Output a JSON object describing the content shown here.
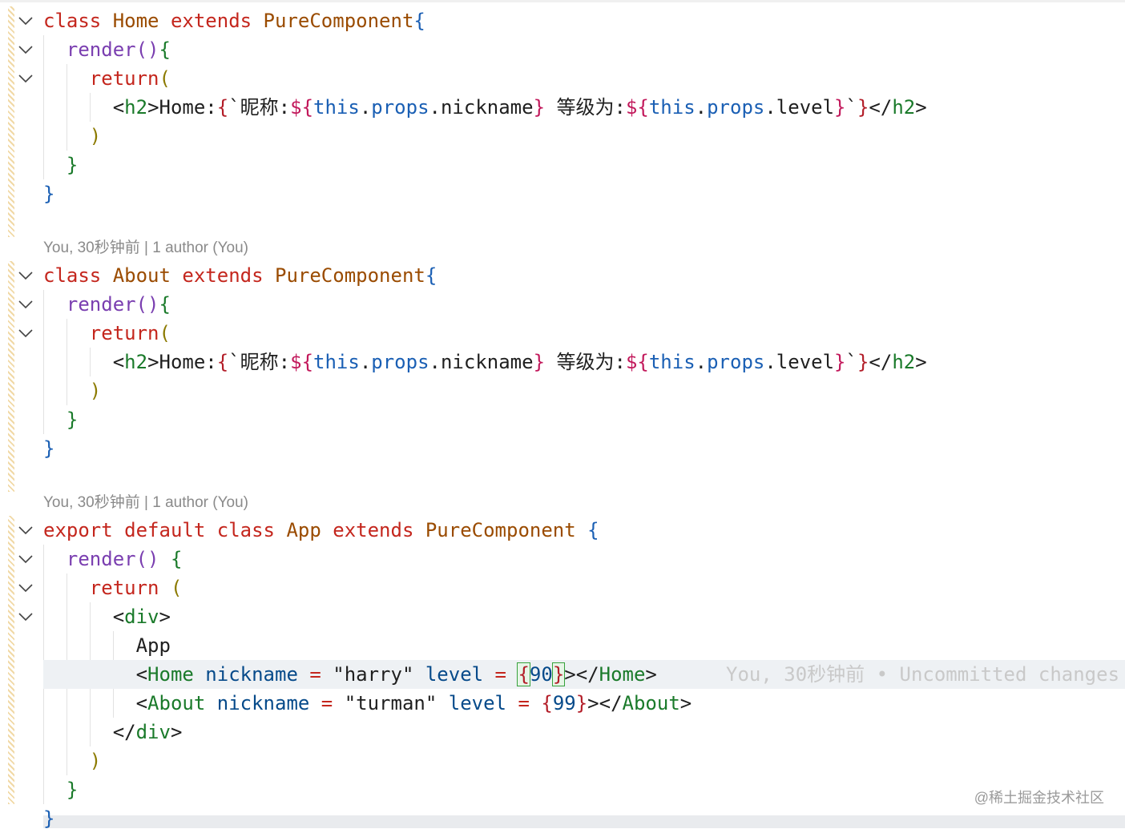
{
  "blocks": [
    {
      "lens": "",
      "lines": [
        [
          [
            "class ",
            "k-red"
          ],
          [
            "Home ",
            "k-cls"
          ],
          [
            "extends ",
            "k-red"
          ],
          [
            "PureComponent",
            "k-cls"
          ],
          [
            "{",
            "k-blue"
          ]
        ],
        [
          [
            "  "
          ],
          [
            "render",
            "k-purple"
          ],
          [
            "()",
            "k-purple"
          ],
          [
            "{",
            "k-green"
          ]
        ],
        [
          [
            "    "
          ],
          [
            "return",
            "k-red"
          ],
          [
            "(",
            "k-olive"
          ]
        ],
        [
          [
            "      "
          ],
          [
            "<",
            "k-dark"
          ],
          [
            "h2",
            "k-green"
          ],
          [
            ">Home:",
            "k-dark"
          ],
          [
            "{",
            "k-red2"
          ],
          [
            "`昵称:",
            "k-dark"
          ],
          [
            "${",
            "k-pink"
          ],
          [
            "this",
            "k-blue"
          ],
          [
            ".",
            "k-dark"
          ],
          [
            "props",
            "k-blue"
          ],
          [
            ".nickname",
            "k-dark"
          ],
          [
            "}",
            "k-pink"
          ],
          [
            " 等级为:",
            "k-dark"
          ],
          [
            "${",
            "k-pink"
          ],
          [
            "this",
            "k-blue"
          ],
          [
            ".",
            "k-dark"
          ],
          [
            "props",
            "k-blue"
          ],
          [
            ".level",
            "k-dark"
          ],
          [
            "}",
            "k-pink"
          ],
          [
            "`",
            "k-dark"
          ],
          [
            "}",
            "k-red2"
          ],
          [
            "</",
            "k-dark"
          ],
          [
            "h2",
            "k-green"
          ],
          [
            ">",
            "k-dark"
          ]
        ],
        [
          [
            "    "
          ],
          [
            ")",
            "k-olive"
          ]
        ],
        [
          [
            "  "
          ],
          [
            "}",
            "k-green"
          ]
        ],
        [
          [
            "}",
            "k-blue"
          ]
        ]
      ]
    },
    {
      "lens": "You, 30秒钟前 | 1 author (You)",
      "lines": [
        [
          [
            "class ",
            "k-red"
          ],
          [
            "About ",
            "k-cls"
          ],
          [
            "extends ",
            "k-red"
          ],
          [
            "PureComponent",
            "k-cls"
          ],
          [
            "{",
            "k-blue"
          ]
        ],
        [
          [
            "  "
          ],
          [
            "render",
            "k-purple"
          ],
          [
            "()",
            "k-purple"
          ],
          [
            "{",
            "k-green"
          ]
        ],
        [
          [
            "    "
          ],
          [
            "return",
            "k-red"
          ],
          [
            "(",
            "k-olive"
          ]
        ],
        [
          [
            "      "
          ],
          [
            "<",
            "k-dark"
          ],
          [
            "h2",
            "k-green"
          ],
          [
            ">Home:",
            "k-dark"
          ],
          [
            "{",
            "k-red2"
          ],
          [
            "`昵称:",
            "k-dark"
          ],
          [
            "${",
            "k-pink"
          ],
          [
            "this",
            "k-blue"
          ],
          [
            ".",
            "k-dark"
          ],
          [
            "props",
            "k-blue"
          ],
          [
            ".nickname",
            "k-dark"
          ],
          [
            "}",
            "k-pink"
          ],
          [
            " 等级为:",
            "k-dark"
          ],
          [
            "${",
            "k-pink"
          ],
          [
            "this",
            "k-blue"
          ],
          [
            ".",
            "k-dark"
          ],
          [
            "props",
            "k-blue"
          ],
          [
            ".level",
            "k-dark"
          ],
          [
            "}",
            "k-pink"
          ],
          [
            "`",
            "k-dark"
          ],
          [
            "}",
            "k-red2"
          ],
          [
            "</",
            "k-dark"
          ],
          [
            "h2",
            "k-green"
          ],
          [
            ">",
            "k-dark"
          ]
        ],
        [
          [
            "    "
          ],
          [
            ")",
            "k-olive"
          ]
        ],
        [
          [
            "  "
          ],
          [
            "}",
            "k-green"
          ]
        ],
        [
          [
            "}",
            "k-blue"
          ]
        ]
      ]
    },
    {
      "lens": "You, 30秒钟前 | 1 author (You)",
      "lines": [
        [
          [
            "export ",
            "k-red"
          ],
          [
            "default ",
            "k-red"
          ],
          [
            "class ",
            "k-red"
          ],
          [
            "App ",
            "k-cls"
          ],
          [
            "extends ",
            "k-red"
          ],
          [
            "PureComponent ",
            "k-cls"
          ],
          [
            "{",
            "k-blue"
          ]
        ],
        [
          [
            "  "
          ],
          [
            "render",
            "k-purple"
          ],
          [
            "() ",
            "k-purple"
          ],
          [
            "{",
            "k-green"
          ]
        ],
        [
          [
            "    "
          ],
          [
            "return ",
            "k-red"
          ],
          [
            "(",
            "k-olive"
          ]
        ],
        [
          [
            "      "
          ],
          [
            "<",
            "k-dark"
          ],
          [
            "div",
            "k-green"
          ],
          [
            ">",
            "k-dark"
          ]
        ],
        [
          [
            "        App",
            "k-dark"
          ]
        ],
        [
          [
            "        "
          ],
          [
            "<",
            "k-dark"
          ],
          [
            "Home ",
            "k-green"
          ],
          [
            "nickname ",
            "k-dblue"
          ],
          [
            "= ",
            "k-red"
          ],
          [
            "\"harry\" ",
            "k-dark"
          ],
          [
            "level ",
            "k-dblue"
          ],
          [
            "= ",
            "k-red"
          ],
          [
            "{",
            "k-red2 br-box"
          ],
          [
            "90",
            "k-dblue"
          ],
          [
            "}",
            "k-red2 br-box"
          ],
          [
            "></",
            "k-dark"
          ],
          [
            "Home",
            "k-green"
          ],
          [
            ">",
            "k-dark"
          ]
        ],
        [
          [
            "        "
          ],
          [
            "<",
            "k-dark"
          ],
          [
            "About ",
            "k-green"
          ],
          [
            "nickname ",
            "k-dblue"
          ],
          [
            "= ",
            "k-red"
          ],
          [
            "\"turman\" ",
            "k-dark"
          ],
          [
            "level ",
            "k-dblue"
          ],
          [
            "= ",
            "k-red"
          ],
          [
            "{",
            "k-red2"
          ],
          [
            "99",
            "k-dblue"
          ],
          [
            "}",
            "k-red2"
          ],
          [
            "></",
            "k-dark"
          ],
          [
            "About",
            "k-green"
          ],
          [
            ">",
            "k-dark"
          ]
        ],
        [
          [
            "      "
          ],
          [
            "</",
            "k-dark"
          ],
          [
            "div",
            "k-green"
          ],
          [
            ">",
            "k-dark"
          ]
        ],
        [
          [
            "    "
          ],
          [
            ")",
            "k-olive"
          ]
        ],
        [
          [
            "  "
          ],
          [
            "}",
            "k-green"
          ]
        ],
        [
          [
            "}",
            "k-blue"
          ]
        ]
      ]
    }
  ],
  "inline_blame": "You, 30秒钟前 • Uncommitted changes",
  "watermark": "@稀土掘金技术社区"
}
